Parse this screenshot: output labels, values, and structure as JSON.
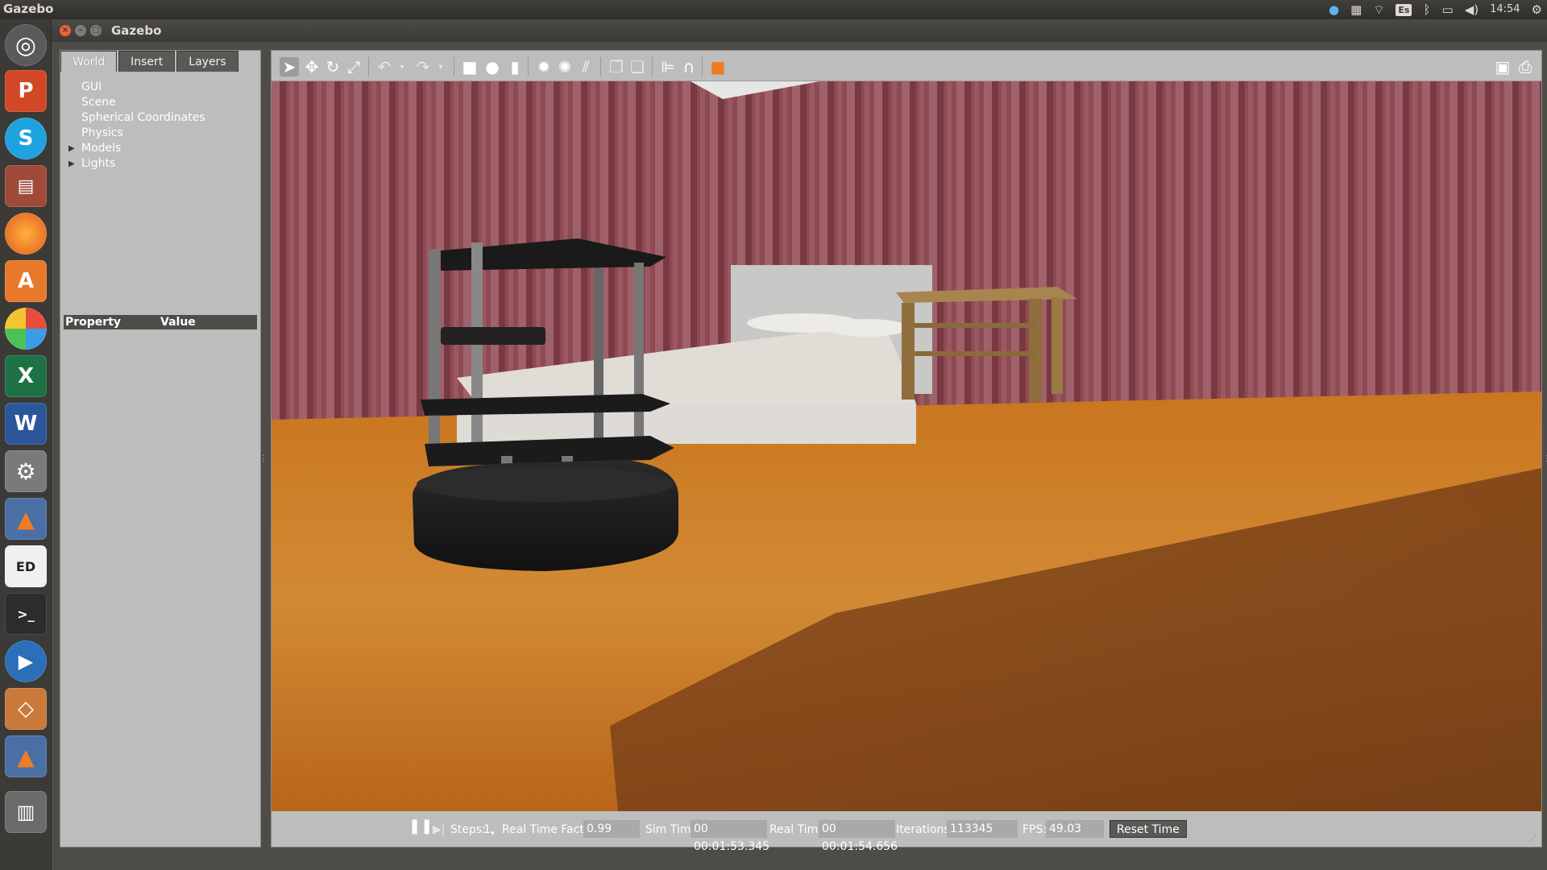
{
  "topbar": {
    "app_name": "Gazebo",
    "keyboard_layout": "Es",
    "clock": "14:54"
  },
  "launcher": {
    "items": [
      {
        "icon": "ubuntu-dash-icon"
      },
      {
        "icon": "powerpoint-icon",
        "glyph": "P"
      },
      {
        "icon": "skype-icon",
        "glyph": "S"
      },
      {
        "icon": "files-icon"
      },
      {
        "icon": "firefox-icon"
      },
      {
        "icon": "software-center-icon",
        "glyph": "A"
      },
      {
        "icon": "photo-app-icon"
      },
      {
        "icon": "excel-icon",
        "glyph": "X"
      },
      {
        "icon": "word-icon",
        "glyph": "W"
      },
      {
        "icon": "system-settings-icon"
      },
      {
        "icon": "matlab-icon"
      },
      {
        "icon": "font-editor-icon",
        "glyph": "ED"
      },
      {
        "icon": "terminal-icon",
        "glyph": ">_"
      },
      {
        "icon": "media-player-icon"
      },
      {
        "icon": "virtualbox-icon"
      },
      {
        "icon": "matlab-icon-2"
      },
      {
        "icon": "trash-icon"
      }
    ]
  },
  "window": {
    "title": "Gazebo"
  },
  "left_panel": {
    "tabs": [
      {
        "label": "World",
        "active": true
      },
      {
        "label": "Insert",
        "active": false
      },
      {
        "label": "Layers",
        "active": false
      }
    ],
    "tree": [
      {
        "label": "GUI",
        "expandable": false
      },
      {
        "label": "Scene",
        "expandable": false
      },
      {
        "label": "Spherical Coordinates",
        "expandable": false
      },
      {
        "label": "Physics",
        "expandable": false
      },
      {
        "label": "Models",
        "expandable": true
      },
      {
        "label": "Lights",
        "expandable": true
      }
    ],
    "property_header": {
      "property": "Property",
      "value": "Value"
    }
  },
  "bottom_bar": {
    "steps_label": "Steps:",
    "steps_value": "1",
    "rtf_label": "Real Time Factor:",
    "rtf_value": "0.99",
    "sim_time_label": "Sim Time:",
    "sim_time_value": "00 00:01:53.345",
    "real_time_label": "Real Time:",
    "real_time_value": "00 00:01:54.656",
    "iterations_label": "Iterations:",
    "iterations_value": "113345",
    "fps_label": "FPS:",
    "fps_value": "49.03",
    "reset_label": "Reset Time"
  }
}
